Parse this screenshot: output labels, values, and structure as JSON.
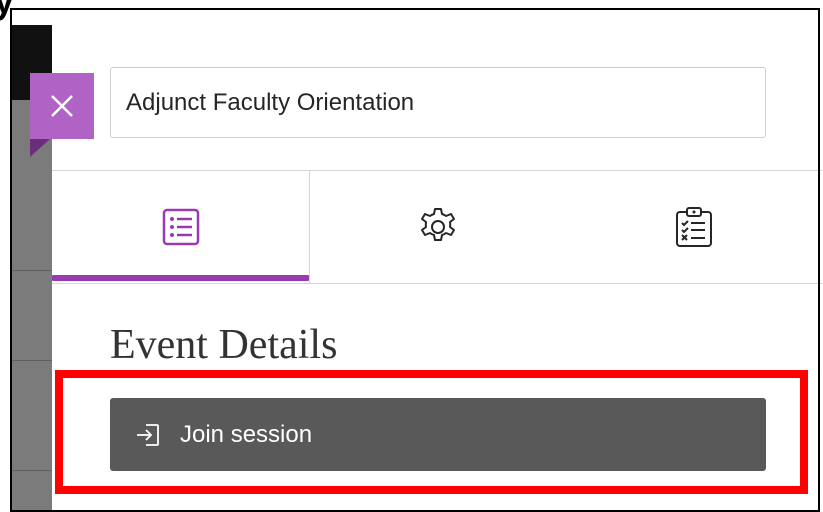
{
  "session": {
    "title_value": "Adjunct Faculty Orientation"
  },
  "tabs": [
    {
      "name": "event-details",
      "icon": "list-icon",
      "active": true
    },
    {
      "name": "settings",
      "icon": "gear-icon",
      "active": false
    },
    {
      "name": "polls",
      "icon": "clipboard-checklist-icon",
      "active": false
    }
  ],
  "main": {
    "heading": "Event Details",
    "join_button_label": "Join session"
  },
  "colors": {
    "accent": "#9a3ab1",
    "close_button": "#b063c5",
    "join_button": "#595959",
    "highlight": "#ff0000"
  },
  "close_button": {
    "icon": "close-icon"
  }
}
